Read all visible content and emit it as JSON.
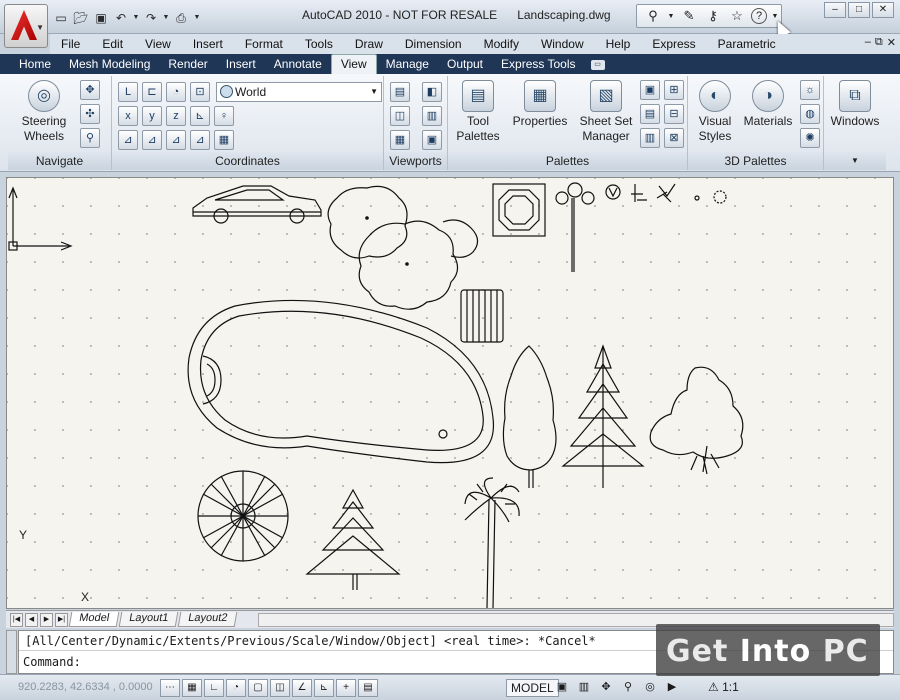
{
  "titlebar": {
    "app": "AutoCAD 2010 - NOT FOR RESALE",
    "document": "Landscaping.dwg",
    "quick_access_icons": [
      "new-icon",
      "open-icon",
      "save-icon",
      "undo-icon",
      "redo-icon",
      "plot-icon"
    ],
    "infocenter_icons": [
      "binoculars-icon",
      "wrench-icon",
      "key-icon",
      "star-icon",
      "help-icon"
    ],
    "window_controls": [
      "minimize",
      "maximize",
      "close"
    ]
  },
  "menubar": [
    "File",
    "Edit",
    "View",
    "Insert",
    "Format",
    "Tools",
    "Draw",
    "Dimension",
    "Modify",
    "Window",
    "Help",
    "Express",
    "Parametric"
  ],
  "ribbon_tabs": [
    "Home",
    "Mesh Modeling",
    "Render",
    "Insert",
    "Annotate",
    "View",
    "Manage",
    "Output",
    "Express Tools"
  ],
  "active_tab": "View",
  "ribbon": {
    "navigate": {
      "label": "Navigate",
      "steering_wheels_line1": "Steering",
      "steering_wheels_line2": "Wheels"
    },
    "coordinates": {
      "label": "Coordinates",
      "ucs_value": "World"
    },
    "viewports": {
      "label": "Viewports"
    },
    "palettes": {
      "label": "Palettes",
      "tool_palettes_line1": "Tool",
      "tool_palettes_line2": "Palettes",
      "properties": "Properties",
      "sheet_set_line1": "Sheet Set",
      "sheet_set_line2": "Manager"
    },
    "palettes3d": {
      "label": "3D Palettes",
      "visual_styles_line1": "Visual",
      "visual_styles_line2": "Styles",
      "materials": "Materials"
    },
    "windows": {
      "label": "Windows"
    }
  },
  "canvas": {
    "ucs_x": "X",
    "ucs_y": "Y"
  },
  "layout_tabs": [
    "Model",
    "Layout1",
    "Layout2"
  ],
  "command": {
    "history": "[All/Center/Dynamic/Extents/Previous/Scale/Window/Object] <real time>: *Cancel*",
    "prompt": "Command:"
  },
  "status": {
    "coordinates": "920.2283, 42.6334 , 0.0000",
    "space": "MODEL",
    "annotation_scale": "1:1"
  },
  "watermark": {
    "part1": "Get ",
    "part2": "Into",
    "part3": " PC"
  }
}
